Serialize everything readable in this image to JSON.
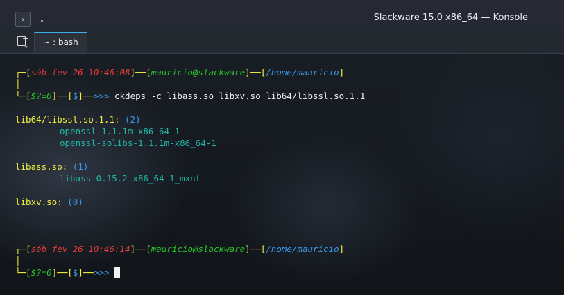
{
  "window": {
    "title": "Slackware 15.0 x86_64 — Konsole"
  },
  "tabs": [
    {
      "label": "~ : bash",
      "active": true
    }
  ],
  "prompt1": {
    "corner_top": "┌─[",
    "datetime": "sáb fev 26 10:46:08",
    "sep1": "]──[",
    "user_host": "mauricio@slackware",
    "sep2": "]──[",
    "path": "/home/mauricio",
    "close": "]",
    "corner_bottom": "└─[",
    "status": "$?=0",
    "sep3": "]──[",
    "sign": "$",
    "sep4": "]──",
    "arrows": ">>>",
    "command": " ckdeps -c libass.so libxv.so lib64/libssl.so.1.1"
  },
  "results": [
    {
      "lib": "lib64/libssl.so.1.1:",
      "count": "(2)",
      "packages": [
        "openssl-1.1.1m-x86_64-1",
        "openssl-solibs-1.1.1m-x86_64-1"
      ]
    },
    {
      "lib": "libass.so:",
      "count": "(1)",
      "packages": [
        "libass-0.15.2-x86_64-1_mxnt"
      ]
    },
    {
      "lib": "libxv.so:",
      "count": "(0)",
      "packages": []
    }
  ],
  "prompt2": {
    "corner_top": "┌─[",
    "datetime": "sáb fev 26 10:46:14",
    "sep1": "]──[",
    "user_host": "mauricio@slackware",
    "sep2": "]──[",
    "path": "/home/mauricio",
    "close": "]",
    "corner_bottom": "└─[",
    "status": "$?=0",
    "sep3": "]──[",
    "sign": "$",
    "sep4": "]──",
    "arrows": ">>>"
  },
  "colors": {
    "frame": "#f1f141",
    "date": "#e53b3b",
    "user": "#27c42a",
    "path": "#3a99ea",
    "package": "#1fb6a6",
    "tab_accent": "#3daee9"
  },
  "icons": [
    "terminal-app-icon",
    "new-tab-icon"
  ]
}
